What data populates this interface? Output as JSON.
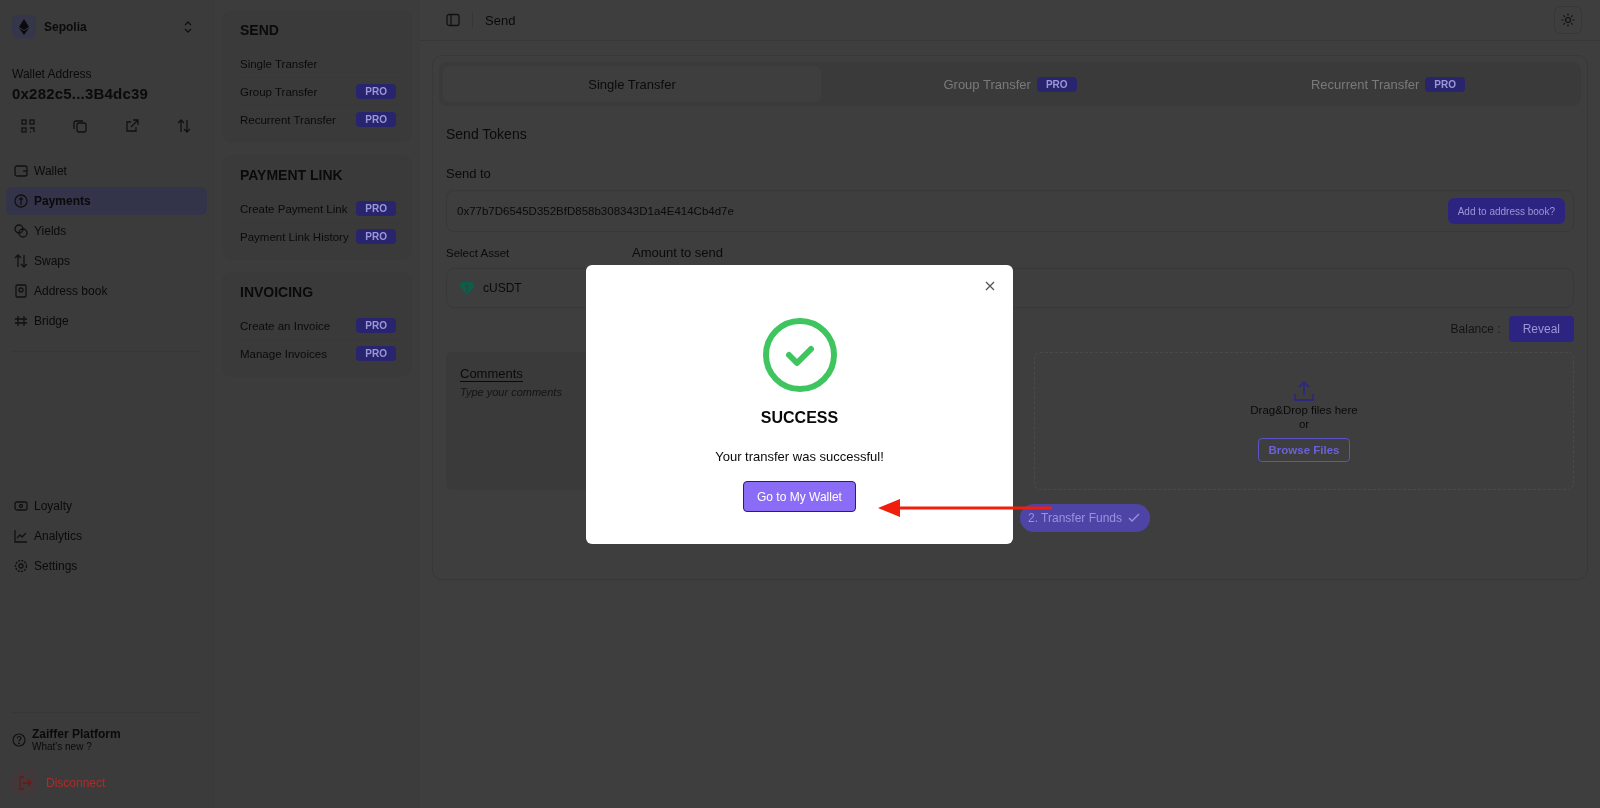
{
  "network": {
    "name": "Sepolia"
  },
  "wallet": {
    "label": "Wallet Address",
    "address": "0x282c5...3B4dc39"
  },
  "nav": [
    {
      "label": "Wallet",
      "selected": false
    },
    {
      "label": "Payments",
      "selected": true
    },
    {
      "label": "Yields",
      "selected": false
    },
    {
      "label": "Swaps",
      "selected": false
    },
    {
      "label": "Address book",
      "selected": false
    },
    {
      "label": "Bridge",
      "selected": false
    }
  ],
  "nav_bottom": [
    {
      "label": "Loyalty",
      "selected": false
    },
    {
      "label": "Analytics",
      "selected": false
    },
    {
      "label": "Settings",
      "selected": false
    }
  ],
  "footer": {
    "title": "Zaiffer Platform",
    "subtitle": "What's new ?",
    "disconnect": "Disconnect"
  },
  "menu_sections": [
    {
      "title": "SEND",
      "items": [
        {
          "label": "Single Transfer"
        },
        {
          "label": "Group Transfer",
          "badge": "PRO"
        },
        {
          "label": "Recurrent Transfer",
          "badge": "PRO"
        }
      ]
    },
    {
      "title": "PAYMENT LINK",
      "items": [
        {
          "label": "Create Payment Link",
          "badge": "PRO"
        },
        {
          "label": "Payment Link History",
          "badge": "PRO"
        }
      ]
    },
    {
      "title": "INVOICING",
      "items": [
        {
          "label": "Create an Invoice",
          "badge": "PRO"
        },
        {
          "label": "Manage Invoices",
          "badge": "PRO"
        }
      ]
    }
  ],
  "header": {
    "title": "Send"
  },
  "tabs": [
    {
      "label": "Single Transfer",
      "selected": true
    },
    {
      "label": "Group Transfer",
      "badge": "PRO",
      "selected": false
    },
    {
      "label": "Recurrent Transfer",
      "badge": "PRO",
      "selected": false
    }
  ],
  "form": {
    "title": "Send Tokens",
    "send_to_label": "Send to",
    "address": "0x77b7D6545D352BfD858b308343D1a4E414Cb4d7e",
    "address_book_button": "Add to address book?",
    "asset_label": "Select Asset",
    "amount_label": "Amount to send",
    "asset": "cUSDT",
    "balance_label": "Balance :",
    "reveal_button": "Reveal",
    "comments_label": "Comments",
    "comments_placeholder": "Type your comments",
    "drop_text": "Drag&Drop files here",
    "drop_or": "or",
    "browse_button": "Browse Files",
    "step_button": "2. Transfer Funds"
  },
  "modal": {
    "title": "SUCCESS",
    "message": "Your transfer was successful!",
    "button": "Go to My Wallet"
  }
}
